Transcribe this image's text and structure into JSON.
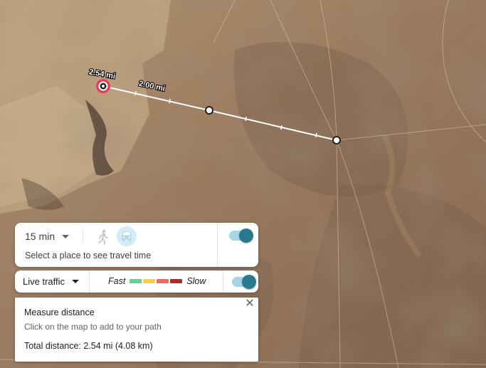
{
  "map": {
    "measure_labels": [
      "2.54 mi",
      "2.00 mi"
    ]
  },
  "travel_time": {
    "duration": "15 min",
    "hint": "Select a place to see travel time",
    "walk_icon": "walk-icon",
    "drive_icon": "car-icon",
    "toggle_on": true
  },
  "traffic": {
    "mode": "Live traffic",
    "fast_label": "Fast",
    "slow_label": "Slow",
    "colors": [
      "#63d297",
      "#ffcf43",
      "#f16c5f",
      "#b22b2b"
    ],
    "toggle_on": true
  },
  "measure": {
    "title": "Measure distance",
    "hint": "Click on the map to add to your path",
    "total": "Total distance: 2.54 mi (4.08 km)",
    "close_icon": "close-icon"
  },
  "colors": {
    "accent": "#2a7a8f",
    "toggle_track": "#a8d5e4",
    "start_marker": "#e5405a"
  }
}
